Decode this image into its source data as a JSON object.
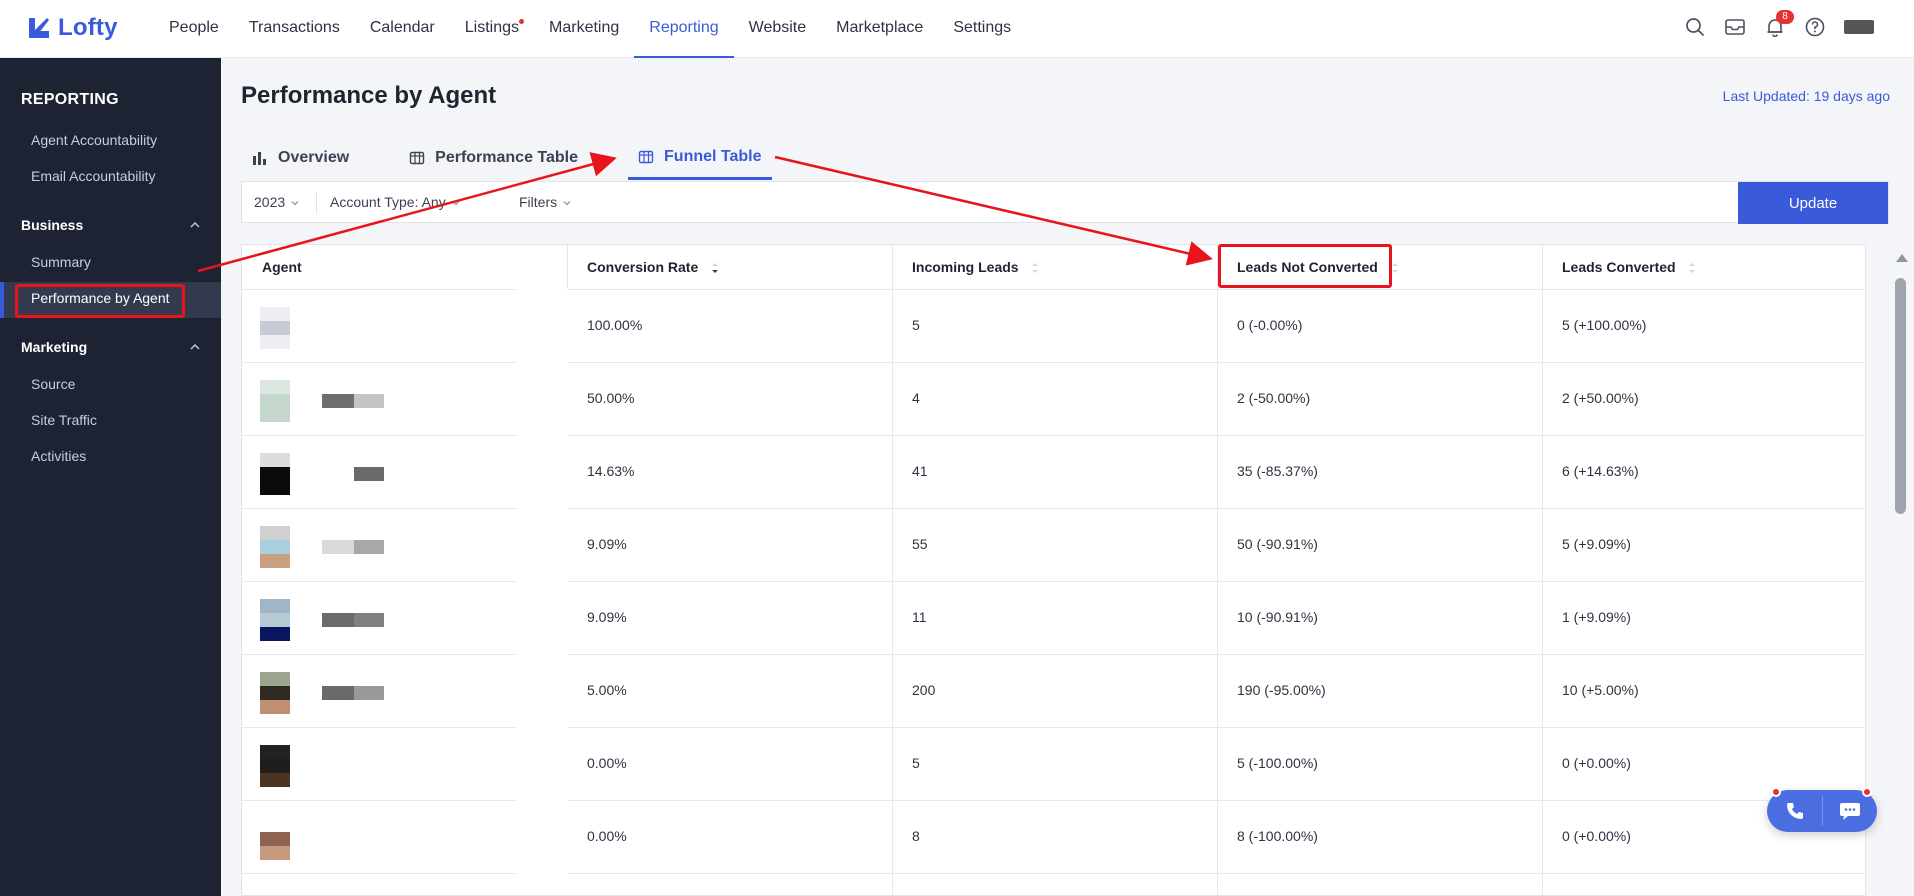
{
  "app": {
    "logo_text": "Lofty"
  },
  "nav": {
    "items": [
      {
        "label": "People"
      },
      {
        "label": "Transactions"
      },
      {
        "label": "Calendar"
      },
      {
        "label": "Listings"
      },
      {
        "label": "Marketing"
      },
      {
        "label": "Reporting"
      },
      {
        "label": "Website"
      },
      {
        "label": "Marketplace"
      },
      {
        "label": "Settings"
      }
    ],
    "active": "Reporting",
    "notification_count": "8"
  },
  "sidebar": {
    "title": "REPORTING",
    "top_items": [
      "Agent Accountability",
      "Email Accountability"
    ],
    "business": {
      "label": "Business",
      "items": [
        "Summary",
        "Performance by Agent"
      ]
    },
    "marketing": {
      "label": "Marketing",
      "items": [
        "Source",
        "Site Traffic",
        "Activities"
      ]
    },
    "active_item": "Performance by Agent"
  },
  "main": {
    "title": "Performance by Agent",
    "last_updated": "Last Updated: 19 days ago",
    "tabs": [
      {
        "label": "Overview",
        "icon": "bar-chart-icon"
      },
      {
        "label": "Performance Table",
        "icon": "table-icon"
      },
      {
        "label": "Funnel Table",
        "icon": "table-icon"
      }
    ],
    "active_tab": "Funnel Table",
    "filters": {
      "year": "2023",
      "account_type": "Account Type: Any",
      "filters": "Filters",
      "update": "Update"
    }
  },
  "table": {
    "columns": [
      "Agent",
      "Conversion Rate",
      "Incoming Leads",
      "Leads Not Converted",
      "Leads Converted"
    ],
    "rows": [
      {
        "conversion_rate": "100.00%",
        "incoming_leads": "5",
        "not_converted": "0 (-0.00%)",
        "converted": "5 (+100.00%)"
      },
      {
        "conversion_rate": "50.00%",
        "incoming_leads": "4",
        "not_converted": "2 (-50.00%)",
        "converted": "2 (+50.00%)"
      },
      {
        "conversion_rate": "14.63%",
        "incoming_leads": "41",
        "not_converted": "35 (-85.37%)",
        "converted": "6 (+14.63%)"
      },
      {
        "conversion_rate": "9.09%",
        "incoming_leads": "55",
        "not_converted": "50 (-90.91%)",
        "converted": "5 (+9.09%)"
      },
      {
        "conversion_rate": "9.09%",
        "incoming_leads": "11",
        "not_converted": "10 (-90.91%)",
        "converted": "1 (+9.09%)"
      },
      {
        "conversion_rate": "5.00%",
        "incoming_leads": "200",
        "not_converted": "190 (-95.00%)",
        "converted": "10 (+5.00%)"
      },
      {
        "conversion_rate": "0.00%",
        "incoming_leads": "5",
        "not_converted": "5 (-100.00%)",
        "converted": "0 (+0.00%)"
      },
      {
        "conversion_rate": "0.00%",
        "incoming_leads": "8",
        "not_converted": "8 (-100.00%)",
        "converted": "0 (+0.00%)"
      }
    ]
  },
  "colors": {
    "accent": "#3a5bd9",
    "annotation_red": "#e8141b",
    "sidebar_bg": "#1e2333"
  }
}
